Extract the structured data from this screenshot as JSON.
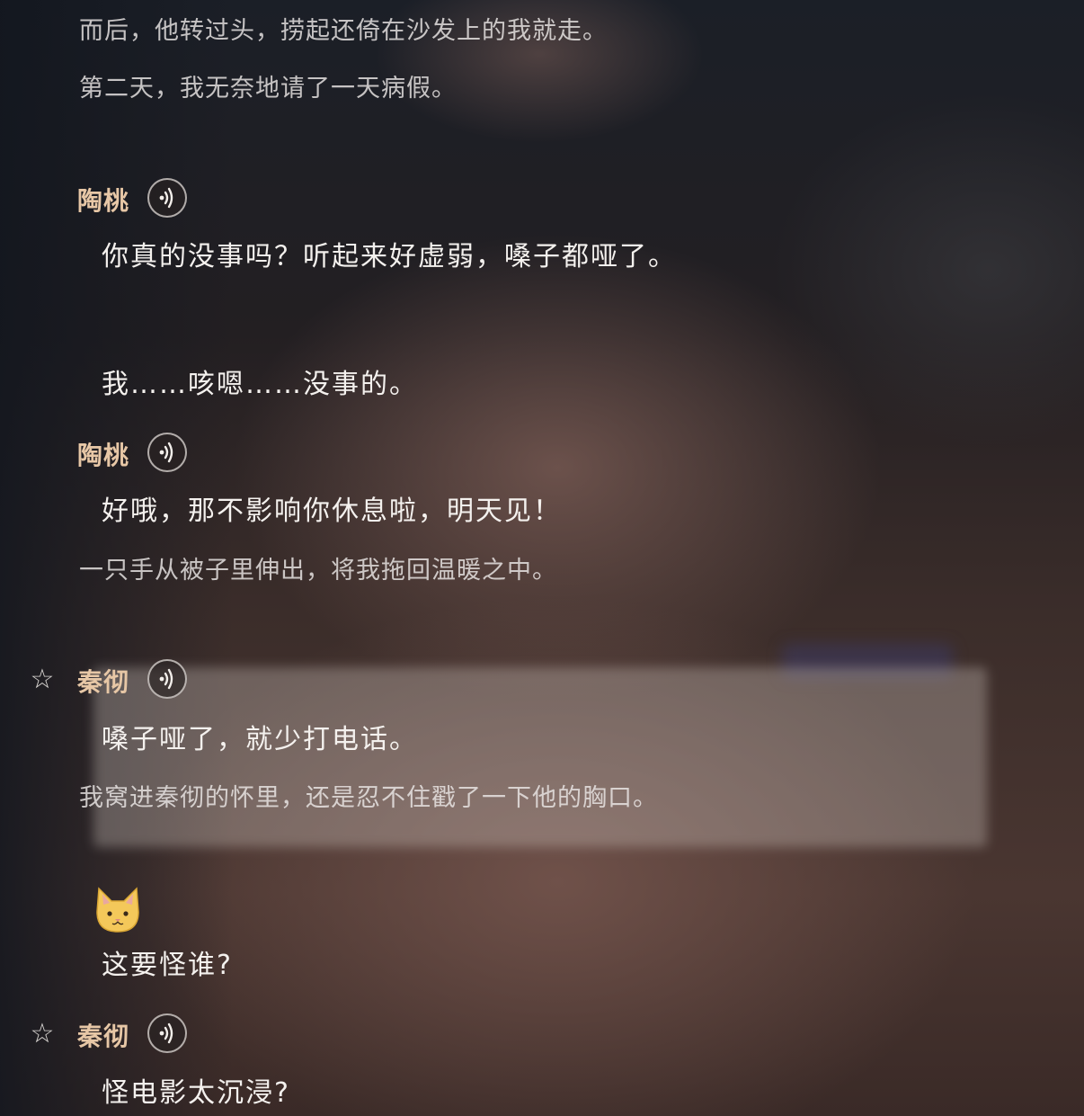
{
  "messages": [
    {
      "type": "narration",
      "text": "而后，他转过头，捞起还倚在沙发上的我就走。"
    },
    {
      "type": "narration",
      "text": "第二天，我无奈地请了一天病假。"
    },
    {
      "type": "speaker",
      "name": "陶桃",
      "star": false
    },
    {
      "type": "dialogue",
      "text": "你真的没事吗？听起来好虚弱，嗓子都哑了。"
    },
    {
      "type": "dialogue",
      "text": "我……咳嗯……没事的。"
    },
    {
      "type": "speaker",
      "name": "陶桃",
      "star": false
    },
    {
      "type": "dialogue",
      "text": "好哦，那不影响你休息啦，明天见！"
    },
    {
      "type": "narration",
      "text": "一只手从被子里伸出，将我拖回温暖之中。"
    },
    {
      "type": "speaker",
      "name": "秦彻",
      "star": true
    },
    {
      "type": "dialogue",
      "text": "嗓子哑了，就少打电话。"
    },
    {
      "type": "narration",
      "text": "我窝进秦彻的怀里，还是忍不住戳了一下他的胸口。"
    },
    {
      "type": "dialogue",
      "text": "这要怪谁?"
    },
    {
      "type": "speaker",
      "name": "秦彻",
      "star": true
    },
    {
      "type": "dialogue",
      "text": "怪电影太沉浸?"
    }
  ],
  "icons": {
    "voice": "voice-wave-icon",
    "star": "star-outline-icon",
    "player_avatar": "cat-face-icon"
  },
  "colors": {
    "speaker_name": "#e7c7a6",
    "dialogue_text": "#f4f1ee",
    "narration_text": "#ece8e6"
  }
}
